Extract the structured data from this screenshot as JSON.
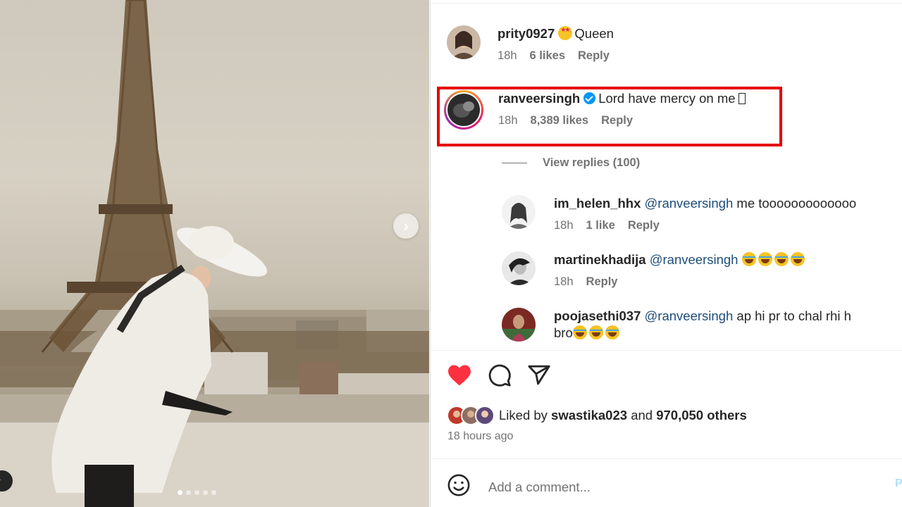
{
  "photo": {
    "next_icon": "chevron-right-icon",
    "carousel_count": 5,
    "carousel_active": 1
  },
  "comments": [
    {
      "username": "prity0927",
      "emoji": "star-struck-emoji",
      "text": "Queen",
      "time": "18h",
      "likes": "6 likes",
      "reply": "Reply"
    },
    {
      "username": "ranveersingh",
      "verified": true,
      "text": "Lord have mercy on me",
      "time": "18h",
      "likes": "8,389 likes",
      "reply": "Reply"
    }
  ],
  "view_replies": "View replies (100)",
  "replies": [
    {
      "username": "im_helen_hhx",
      "mention": "@ranveersingh",
      "text": "me tooooooooooooo",
      "time": "18h",
      "likes": "1 like",
      "reply": "Reply"
    },
    {
      "username": "martinekhadija",
      "mention": "@ranveersingh",
      "emojis": [
        "laughing-emoji",
        "laughing-emoji",
        "laughing-emoji",
        "laughing-emoji"
      ],
      "time": "18h",
      "reply": "Reply"
    },
    {
      "username": "poojasethi037",
      "mention": "@ranveersingh",
      "text": "ap hi pr to chal rhi h",
      "text2": "bro"
    }
  ],
  "actions": {
    "like_icon": "heart-filled-icon",
    "comment_icon": "comment-icon",
    "share_icon": "send-icon"
  },
  "likes_summary": {
    "prefix": "Liked by",
    "user": "swastika023",
    "and": "and",
    "others": "970,050 others"
  },
  "timestamp": "18 hours ago",
  "add_comment": {
    "placeholder": "Add a comment...",
    "post": "P"
  },
  "colors": {
    "like_red": "#ff3040",
    "highlight_red": "#e60000",
    "link_blue": "#1f4e79",
    "verified_blue": "#0095f6"
  }
}
